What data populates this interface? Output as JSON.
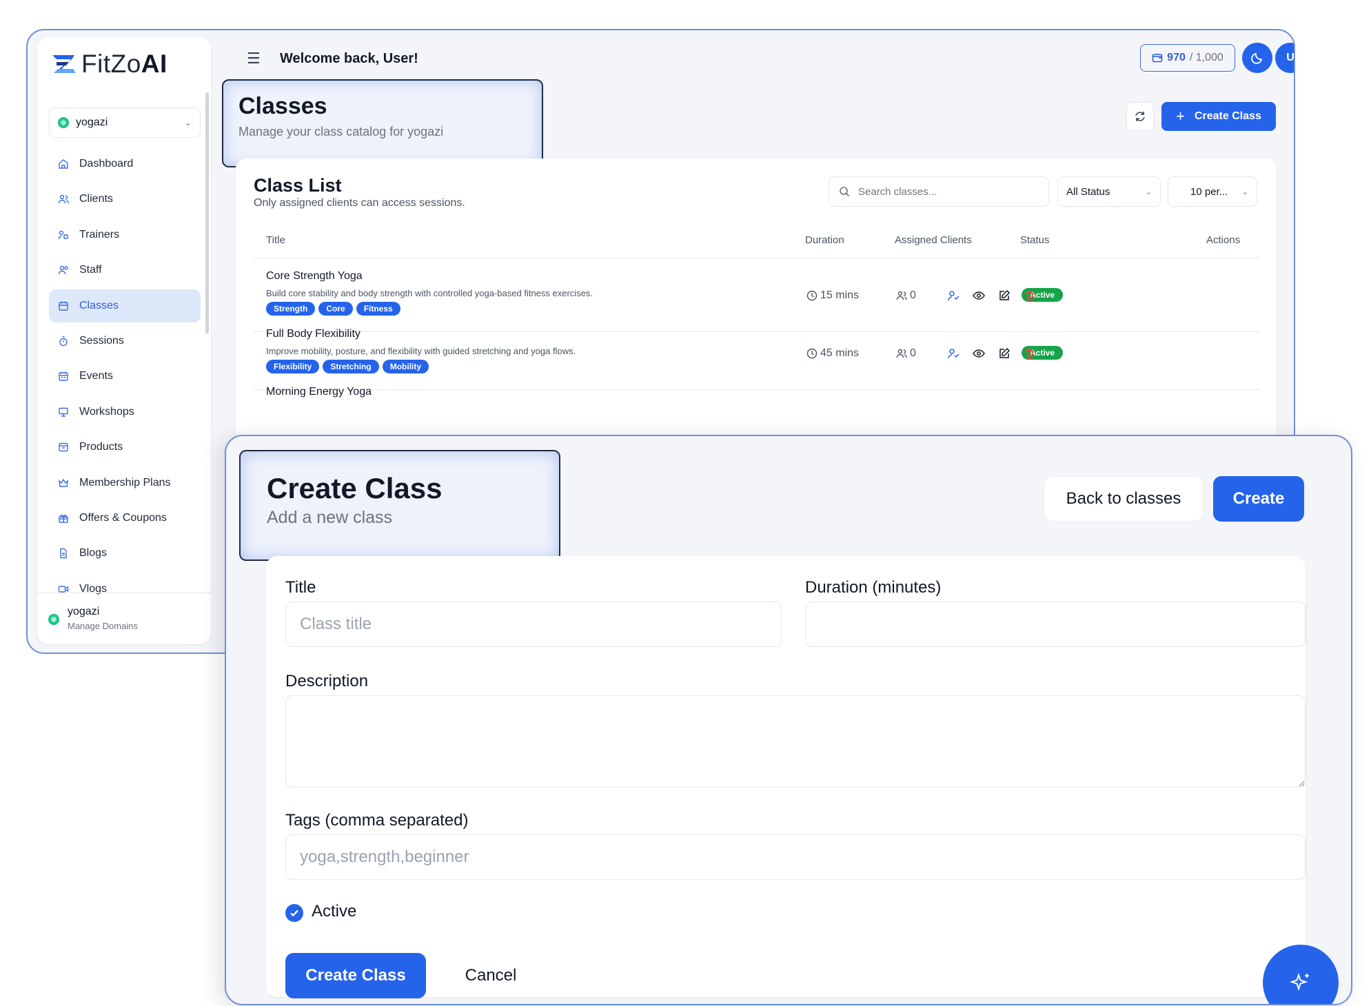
{
  "app": {
    "logo_text_light": "FitZo",
    "logo_text_bold": "AI",
    "tenant": "yogazi"
  },
  "sidebar": {
    "items": [
      {
        "label": "Dashboard",
        "icon": "home-icon"
      },
      {
        "label": "Clients",
        "icon": "users-icon"
      },
      {
        "label": "Trainers",
        "icon": "trainer-icon"
      },
      {
        "label": "Staff",
        "icon": "staff-icon"
      },
      {
        "label": "Classes",
        "icon": "calendar-icon",
        "active": true
      },
      {
        "label": "Sessions",
        "icon": "stopwatch-icon"
      },
      {
        "label": "Events",
        "icon": "calendar-event-icon"
      },
      {
        "label": "Workshops",
        "icon": "presentation-icon"
      },
      {
        "label": "Products",
        "icon": "box-icon"
      },
      {
        "label": "Membership Plans",
        "icon": "crown-icon"
      },
      {
        "label": "Offers & Coupons",
        "icon": "gift-icon"
      },
      {
        "label": "Blogs",
        "icon": "document-icon"
      },
      {
        "label": "Vlogs",
        "icon": "video-icon"
      }
    ],
    "footer_name": "yogazi",
    "footer_sub": "Manage Domains"
  },
  "topbar": {
    "welcome": "Welcome back, User!",
    "credits_used": "970",
    "credits_total": "/ 1,000",
    "avatar_initial": "U"
  },
  "classes_page": {
    "title": "Classes",
    "subtitle": "Manage your class catalog for yogazi",
    "create_label": "Create Class"
  },
  "class_list": {
    "title": "Class List",
    "subtitle": "Only assigned clients can access sessions.",
    "search_placeholder": "Search classes...",
    "status_filter": "All Status",
    "per_page": "10 per...",
    "headers": {
      "title": "Title",
      "duration": "Duration",
      "clients": "Assigned Clients",
      "status": "Status",
      "actions": "Actions"
    },
    "rows": [
      {
        "title": "Core Strength Yoga",
        "description": "Build core stability and body strength with controlled yoga-based fitness exercises.",
        "tags": [
          "Strength",
          "Core",
          "Fitness"
        ],
        "duration": "15 mins",
        "clients": "0",
        "status": "Active"
      },
      {
        "title": "Full Body Flexibility",
        "description": "Improve mobility, posture, and flexibility with guided stretching and yoga flows.",
        "tags": [
          "Flexibility",
          "Stretching",
          "Mobility"
        ],
        "duration": "45 mins",
        "clients": "0",
        "status": "Active"
      },
      {
        "title": "Morning Energy Yoga"
      }
    ]
  },
  "create_form": {
    "title": "Create Class",
    "subtitle": "Add a new class",
    "back_label": "Back to classes",
    "create_label": "Create",
    "title_label": "Title",
    "title_placeholder": "Class title",
    "duration_label": "Duration (minutes)",
    "duration_value": "",
    "description_label": "Description",
    "tags_label": "Tags (comma separated)",
    "tags_placeholder": "yoga,strength,beginner",
    "active_label": "Active",
    "active_checked": true,
    "submit_label": "Create Class",
    "cancel_label": "Cancel"
  },
  "colors": {
    "primary": "#2563eb",
    "active_green": "#16a34a",
    "delete_red": "#ef4444",
    "frame_border": "#6f8fd9"
  }
}
